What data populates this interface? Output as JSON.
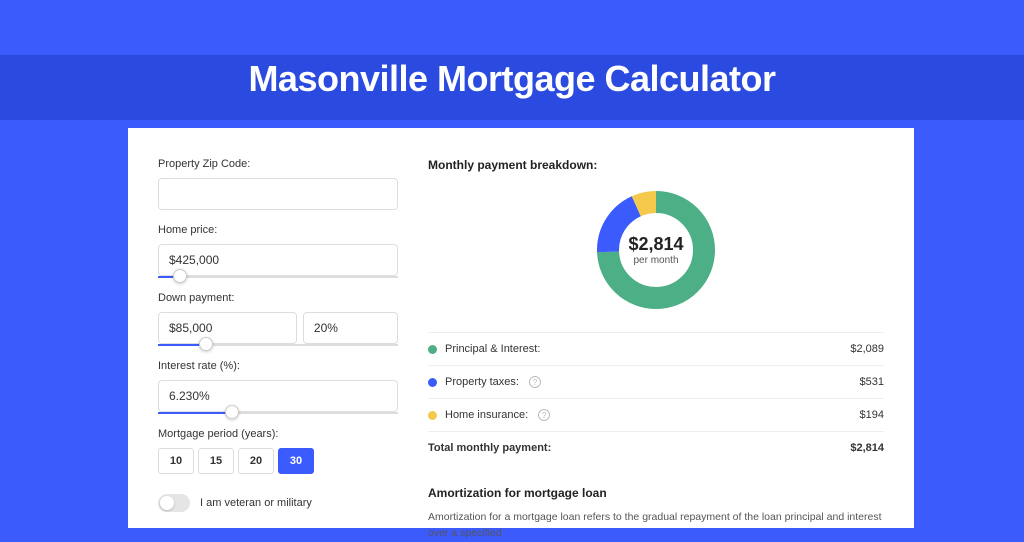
{
  "title": "Masonville Mortgage Calculator",
  "form": {
    "zip_label": "Property Zip Code:",
    "zip_value": "",
    "home_price_label": "Home price:",
    "home_price_value": "$425,000",
    "home_price_slider_pct": 9,
    "down_payment_label": "Down payment:",
    "down_payment_value": "$85,000",
    "down_payment_pct_value": "20%",
    "down_payment_slider_pct": 20,
    "interest_label": "Interest rate (%):",
    "interest_value": "6.230%",
    "interest_slider_pct": 31,
    "period_label": "Mortgage period (years):",
    "periods": [
      "10",
      "15",
      "20",
      "30"
    ],
    "period_active_index": 3,
    "veteran_label": "I am veteran or military"
  },
  "breakdown": {
    "title": "Monthly payment breakdown:",
    "center_amount": "$2,814",
    "center_sub": "per month",
    "items": [
      {
        "label": "Principal & Interest:",
        "value": "$2,089",
        "color": "green",
        "info": false
      },
      {
        "label": "Property taxes:",
        "value": "$531",
        "color": "blue",
        "info": true
      },
      {
        "label": "Home insurance:",
        "value": "$194",
        "color": "yellow",
        "info": true
      }
    ],
    "total_label": "Total monthly payment:",
    "total_value": "$2,814"
  },
  "amortization": {
    "title": "Amortization for mortgage loan",
    "text": "Amortization for a mortgage loan refers to the gradual repayment of the loan principal and interest over a specified"
  },
  "chart_data": {
    "type": "pie",
    "title": "Monthly payment breakdown",
    "series": [
      {
        "name": "Principal & Interest",
        "value": 2089,
        "color": "#4caf85"
      },
      {
        "name": "Property taxes",
        "value": 531,
        "color": "#3b5bfd"
      },
      {
        "name": "Home insurance",
        "value": 194,
        "color": "#f4c94c"
      }
    ],
    "total": 2814,
    "unit": "USD per month"
  }
}
